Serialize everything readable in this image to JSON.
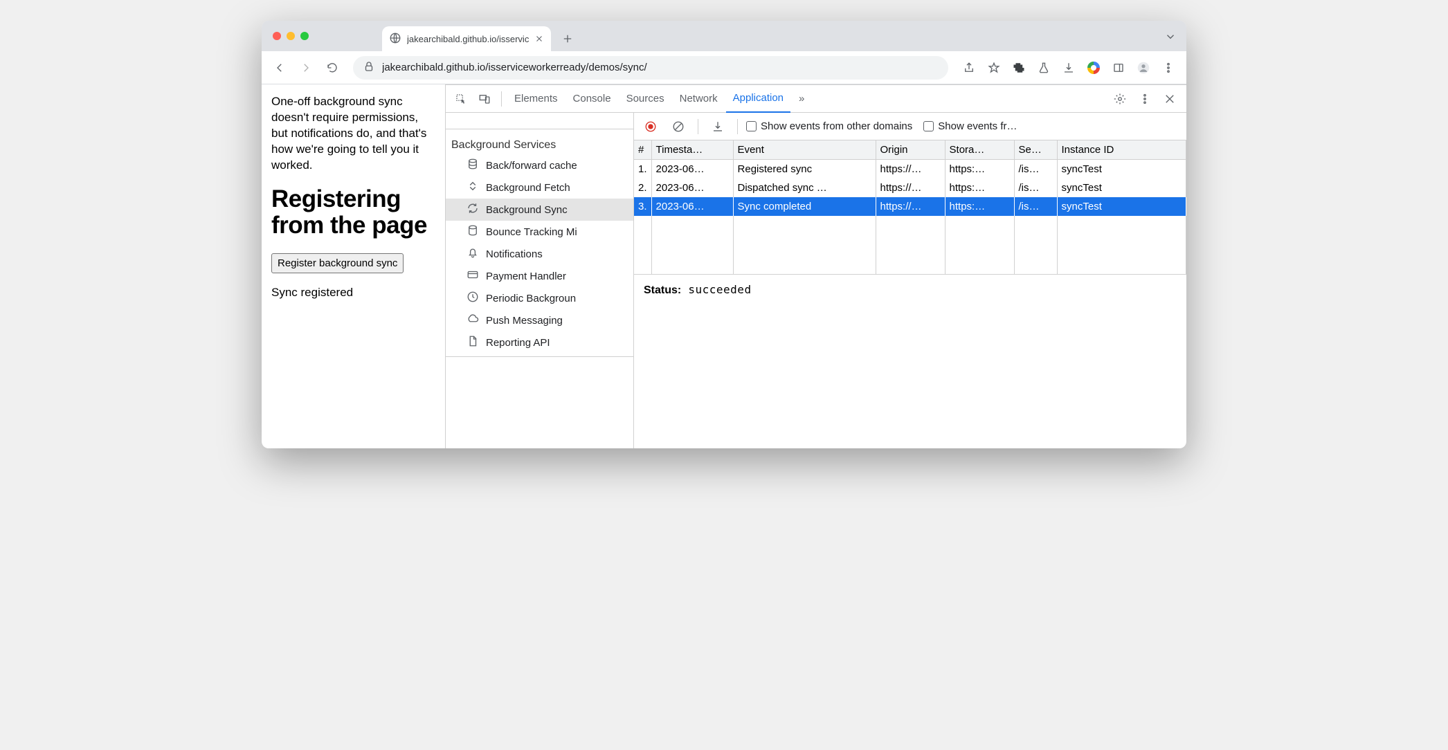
{
  "tab": {
    "title": "jakearchibald.github.io/isservic"
  },
  "url": "jakearchibald.github.io/isserviceworkerready/demos/sync/",
  "page": {
    "intro": "One-off background sync doesn't require permissions, but notifications do, and that's how we're going to tell you it worked.",
    "heading": "Registering from the page",
    "button": "Register background sync",
    "status": "Sync registered"
  },
  "devtools": {
    "tabs": [
      "Elements",
      "Console",
      "Sources",
      "Network",
      "Application"
    ],
    "active_tab": "Application",
    "more": "»",
    "sidebar": {
      "section": "Background Services",
      "items": [
        "Back/forward cache",
        "Background Fetch",
        "Background Sync",
        "Bounce Tracking Mi",
        "Notifications",
        "Payment Handler",
        "Periodic Backgroun",
        "Push Messaging",
        "Reporting API"
      ],
      "selected": "Background Sync"
    },
    "toolbar": {
      "checkbox1": "Show events from other domains",
      "checkbox2": "Show events fr…"
    },
    "table": {
      "columns": [
        "#",
        "Timesta…",
        "Event",
        "Origin",
        "Stora…",
        "Se…",
        "Instance ID"
      ],
      "rows": [
        {
          "n": "1.",
          "ts": "2023-06…",
          "event": "Registered sync",
          "origin": "https://…",
          "storage": "https:…",
          "scope": "/is…",
          "id": "syncTest",
          "selected": false
        },
        {
          "n": "2.",
          "ts": "2023-06…",
          "event": "Dispatched sync …",
          "origin": "https://…",
          "storage": "https:…",
          "scope": "/is…",
          "id": "syncTest",
          "selected": false
        },
        {
          "n": "3.",
          "ts": "2023-06…",
          "event": "Sync completed",
          "origin": "https://…",
          "storage": "https:…",
          "scope": "/is…",
          "id": "syncTest",
          "selected": true
        }
      ]
    },
    "status_label": "Status:",
    "status_value": "succeeded"
  }
}
